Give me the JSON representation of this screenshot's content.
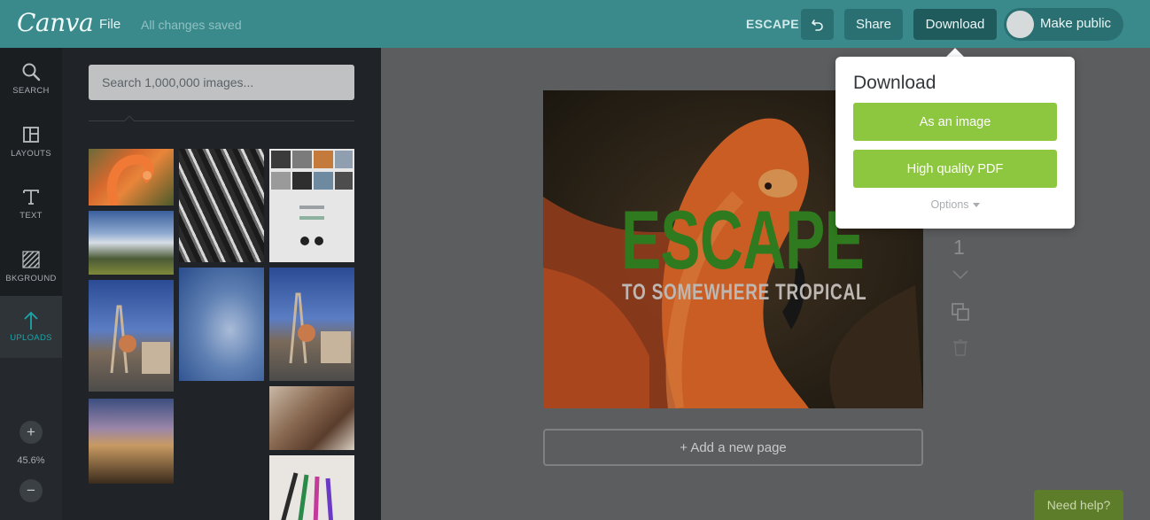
{
  "app": {
    "logo": "Canva",
    "file_menu": "File",
    "save_status": "All changes saved"
  },
  "toolbar": {
    "doc_title": "ESCAPE",
    "undo_icon": "undo-icon",
    "share_label": "Share",
    "download_label": "Download",
    "make_public_label": "Make public"
  },
  "sidebar": {
    "items": [
      {
        "label": "SEARCH",
        "icon": "search-icon"
      },
      {
        "label": "LAYOUTS",
        "icon": "layouts-icon"
      },
      {
        "label": "TEXT",
        "icon": "text-icon"
      },
      {
        "label": "BKGROUND",
        "icon": "background-icon"
      },
      {
        "label": "UPLOADS",
        "icon": "upload-icon",
        "active": true
      }
    ],
    "zoom_in": "+",
    "zoom_level": "45.6%",
    "zoom_out": "−"
  },
  "panel": {
    "search_placeholder": "Search 1,000,000 images..."
  },
  "design": {
    "headline": "ESCAPE",
    "subheadline": "TO SOMEWHERE TROPICAL",
    "page_number": "1",
    "add_page_label": "+ Add a new page"
  },
  "download_menu": {
    "title": "Download",
    "as_image_label": "As an image",
    "pdf_label": "High quality PDF",
    "options_label": "Options"
  },
  "help": {
    "label": "Need help?"
  },
  "colors": {
    "topbar": "#3a8a8c",
    "accent_green": "#8dc63f",
    "headline_green": "#2f7a1f",
    "active_teal": "#1aa5a8"
  }
}
